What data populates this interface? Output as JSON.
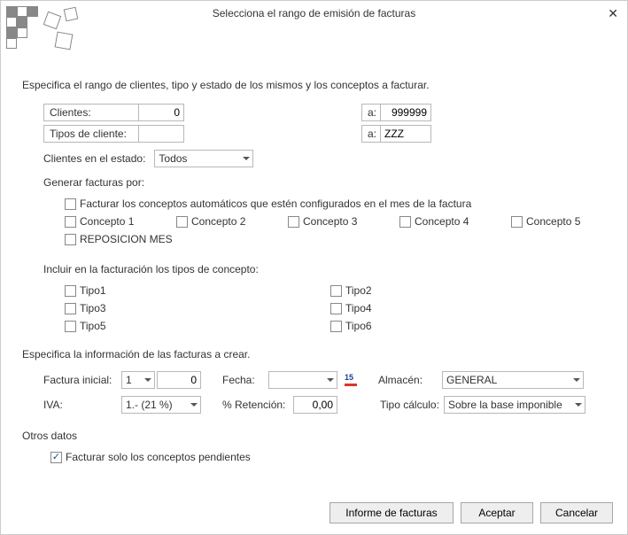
{
  "dialog": {
    "title": "Selecciona el rango de emisión de facturas"
  },
  "intro": "Especifica el rango de clientes, tipo y estado de los mismos y los conceptos a facturar.",
  "range": {
    "clientes_label": "Clientes:",
    "clientes_from": "0",
    "a_label": "a:",
    "clientes_to": "999999",
    "tipos_label": "Tipos de cliente:",
    "tipos_from": "",
    "tipos_to": "ZZZ",
    "estado_label": "Clientes en el estado:",
    "estado_value": "Todos"
  },
  "generar": {
    "title": "Generar facturas por:",
    "auto": "Facturar los conceptos automáticos que estén configurados en el mes de la factura",
    "c1": "Concepto 1",
    "c2": "Concepto 2",
    "c3": "Concepto 3",
    "c4": "Concepto 4",
    "c5": "Concepto 5",
    "repo": "REPOSICION MES"
  },
  "incluir": {
    "title": "Incluir en la facturación los tipos de concepto:",
    "t1": "Tipo1",
    "t2": "Tipo2",
    "t3": "Tipo3",
    "t4": "Tipo4",
    "t5": "Tipo5",
    "t6": "Tipo6"
  },
  "crear": {
    "title": "Especifica la información de las facturas a crear.",
    "factura_inicial_label": "Factura inicial:",
    "factura_serie": "1",
    "factura_num": "0",
    "fecha_label": "Fecha:",
    "fecha_value": "",
    "almacen_label": "Almacén:",
    "almacen_value": "GENERAL",
    "iva_label": "IVA:",
    "iva_value": "1.- (21 %)",
    "retencion_label": "% Retención:",
    "retencion_value": "0,00",
    "tipo_calc_label": "Tipo cálculo:",
    "tipo_calc_value": "Sobre la base imponible"
  },
  "otros": {
    "title": "Otros datos",
    "pendientes": "Facturar solo los conceptos pendientes"
  },
  "buttons": {
    "informe": "Informe de facturas",
    "aceptar": "Aceptar",
    "cancelar": "Cancelar"
  }
}
